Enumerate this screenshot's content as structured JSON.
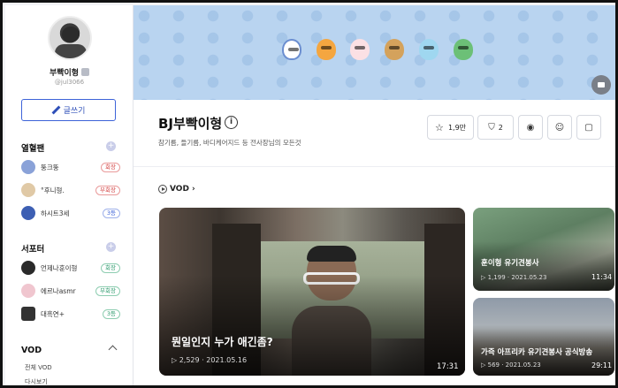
{
  "profile": {
    "nickname": "부빡이형",
    "user_id": "@jul3066",
    "write_button": "글쓰기"
  },
  "fans": {
    "title": "열혈팬",
    "items": [
      {
        "name": "뚱크뚱",
        "tag": "회장"
      },
      {
        "name": "°후니형.",
        "tag": "부회장"
      },
      {
        "name": "하시트3세",
        "tag": "3등"
      }
    ]
  },
  "supporters": {
    "title": "서포터",
    "items": [
      {
        "name": "언제나훈이형",
        "tag": "회장"
      },
      {
        "name": "에르나asmr",
        "tag": "부회장"
      },
      {
        "name": "대흑연+",
        "tag": "3등"
      }
    ]
  },
  "sidebar_vod": {
    "title": "VOD",
    "links": [
      "전체 VOD",
      "다시보기"
    ]
  },
  "channel": {
    "title": "BJ부빡이형",
    "description": "참기름, 들기름, 바디케어지드 등 전사장님의 모든것",
    "subscribers": "1,9만",
    "notify_count": "2"
  },
  "vod": {
    "heading": "VOD",
    "heading_chevron": "›",
    "main": {
      "title": "뭔일인지 누가 애긴좀?",
      "views": "2,529",
      "date": "2021.05.16",
      "duration": "17:31"
    },
    "side": [
      {
        "title": "훈이형 유기견봉사",
        "views": "1,199",
        "date": "2021.05.23",
        "duration": "11:34"
      },
      {
        "title": "가즉 아프리카 유기견봉사 공식방송",
        "views": "569",
        "date": "2021.05.23",
        "duration": "29:11"
      }
    ]
  },
  "icons": [
    "pencil-icon",
    "star-icon",
    "bookmark-icon",
    "location-icon",
    "emoji-icon",
    "sticker-icon",
    "youtube-icon",
    "play-icon"
  ],
  "colors": {
    "accent": "#3d63d8",
    "banner": "#b9d4f0",
    "tag_red": "#d34040",
    "tag_blue": "#3d63d8",
    "tag_green": "#2c9a6c"
  }
}
